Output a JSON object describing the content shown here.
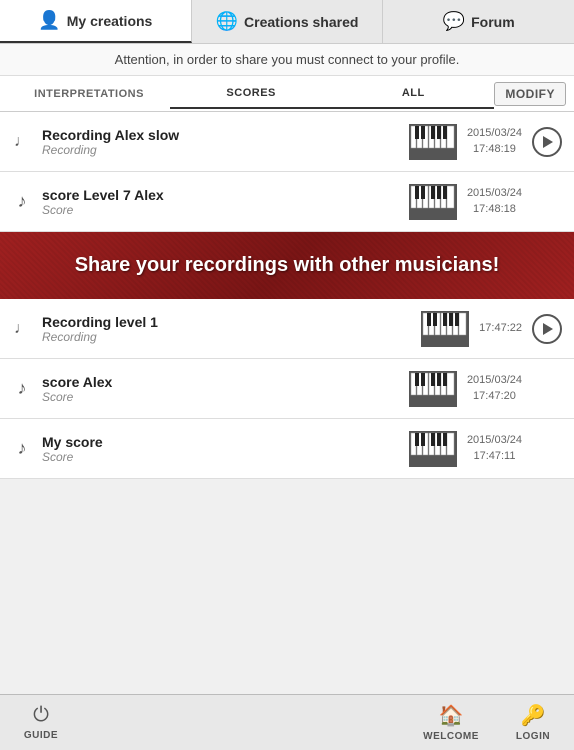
{
  "nav": {
    "items": [
      {
        "id": "my-creations",
        "label": "My creations",
        "icon": "👤",
        "active": true
      },
      {
        "id": "creations-shared",
        "label": "Creations shared",
        "icon": "🌐",
        "active": false
      },
      {
        "id": "forum",
        "label": "Forum",
        "icon": "💬",
        "active": false
      }
    ]
  },
  "attention": {
    "text": "Attention, in order to share you must connect to your profile."
  },
  "filters": {
    "tabs": [
      {
        "id": "interpretations",
        "label": "INTERPRETATIONS",
        "active": false
      },
      {
        "id": "scores",
        "label": "SCORES",
        "active": false
      },
      {
        "id": "all",
        "label": "ALL",
        "active": true
      }
    ],
    "modify_label": "MODIFY"
  },
  "items": [
    {
      "id": "item-1",
      "title": "Recording Alex slow",
      "subtitle": "Recording",
      "date_line1": "2015/03/24",
      "date_line2": "17:48:19",
      "has_play": true,
      "icon_type": "recording"
    },
    {
      "id": "item-2",
      "title": "score Level 7 Alex",
      "subtitle": "Score",
      "date_line1": "2015/03/24",
      "date_line2": "17:48:18",
      "has_play": false,
      "icon_type": "score"
    },
    {
      "id": "item-3",
      "title": "Recording level 1",
      "subtitle": "Recording",
      "date_line1": "",
      "date_line2": "17:47:22",
      "has_play": true,
      "icon_type": "recording",
      "partial": true
    },
    {
      "id": "item-4",
      "title": "score Alex",
      "subtitle": "Score",
      "date_line1": "2015/03/24",
      "date_line2": "17:47:20",
      "has_play": false,
      "icon_type": "score"
    },
    {
      "id": "item-5",
      "title": "My score",
      "subtitle": "Score",
      "date_line1": "2015/03/24",
      "date_line2": "17:47:11",
      "has_play": false,
      "icon_type": "score"
    }
  ],
  "promo": {
    "text": "Share your recordings with other musicians!"
  },
  "bottom_nav": {
    "items": [
      {
        "id": "guide",
        "label": "GUIDE",
        "icon": "⏻"
      },
      {
        "id": "welcome",
        "label": "WELCOME",
        "icon": "🏠"
      },
      {
        "id": "login",
        "label": "LOGIN",
        "icon": "🔑"
      }
    ]
  }
}
